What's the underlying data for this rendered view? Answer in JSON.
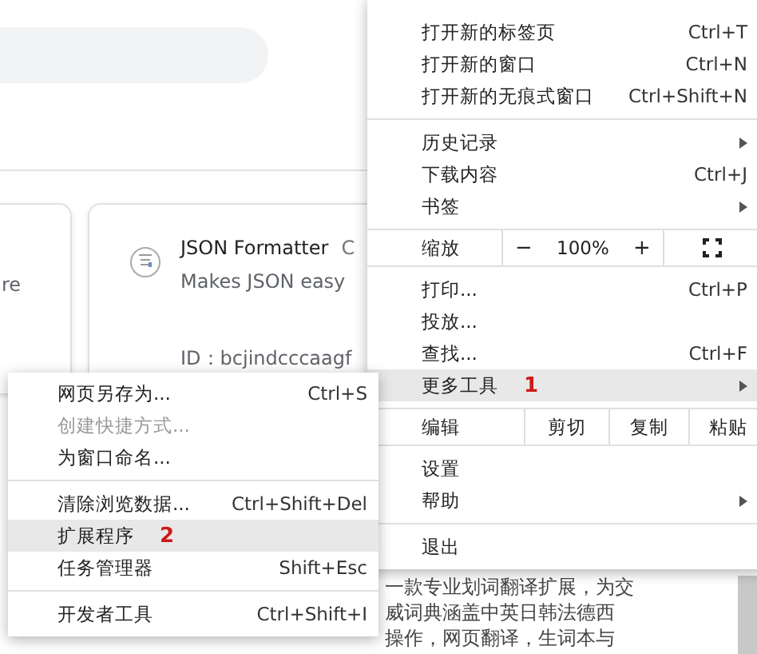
{
  "page": {
    "cards": [
      {
        "description": "re"
      },
      {
        "name": "JSON Formatter",
        "tail": "C",
        "description": "Makes JSON easy",
        "id": "ID：bcjindcccaagf"
      }
    ],
    "text_lines": [
      "一款专业划词翻译扩展，为交",
      "威词典涵盖中英日韩法德西",
      "操作，网页翻译，生词本与"
    ]
  },
  "menu": [
    {
      "kind": "item",
      "label": "打开新的标签页",
      "shortcut": "Ctrl+T"
    },
    {
      "kind": "item",
      "label": "打开新的窗口",
      "shortcut": "Ctrl+N"
    },
    {
      "kind": "item",
      "label": "打开新的无痕式窗口",
      "shortcut": "Ctrl+Shift+N"
    },
    {
      "kind": "separator"
    },
    {
      "kind": "submenu",
      "label": "历史记录",
      "selected": false
    },
    {
      "kind": "item",
      "label": "下载内容",
      "shortcut": "Ctrl+J"
    },
    {
      "kind": "submenu",
      "label": "书签",
      "selected": false
    },
    {
      "kind": "zoom",
      "label": "缩放",
      "minus": "−",
      "value": "100%",
      "plus": "+"
    },
    {
      "kind": "item",
      "label": "打印...",
      "shortcut": "Ctrl+P"
    },
    {
      "kind": "item",
      "label": "投放..."
    },
    {
      "kind": "item",
      "label": "查找...",
      "shortcut": "Ctrl+F"
    },
    {
      "kind": "submenu",
      "label": "更多工具",
      "selected": true,
      "annotation": "1"
    },
    {
      "kind": "edit",
      "label": "编辑",
      "buttons": [
        "剪切",
        "复制",
        "粘贴"
      ]
    },
    {
      "kind": "item",
      "label": "设置"
    },
    {
      "kind": "submenu",
      "label": "帮助",
      "selected": false
    },
    {
      "kind": "separator"
    },
    {
      "kind": "item",
      "label": "退出"
    }
  ],
  "submenu": [
    {
      "kind": "item",
      "label": "网页另存为...",
      "shortcut": "Ctrl+S",
      "disabled": false,
      "selected": false
    },
    {
      "kind": "item",
      "label": "创建快捷方式...",
      "disabled": true,
      "selected": false
    },
    {
      "kind": "item",
      "label": "为窗口命名...",
      "disabled": false,
      "selected": false
    },
    {
      "kind": "separator"
    },
    {
      "kind": "item",
      "label": "清除浏览数据...",
      "shortcut": "Ctrl+Shift+Del",
      "disabled": false,
      "selected": false
    },
    {
      "kind": "item",
      "label": "扩展程序",
      "disabled": false,
      "selected": true,
      "annotation": "2"
    },
    {
      "kind": "item",
      "label": "任务管理器",
      "shortcut": "Shift+Esc",
      "disabled": false,
      "selected": false
    },
    {
      "kind": "separator"
    },
    {
      "kind": "item",
      "label": "开发者工具",
      "shortcut": "Ctrl+Shift+I",
      "disabled": false,
      "selected": false
    }
  ]
}
